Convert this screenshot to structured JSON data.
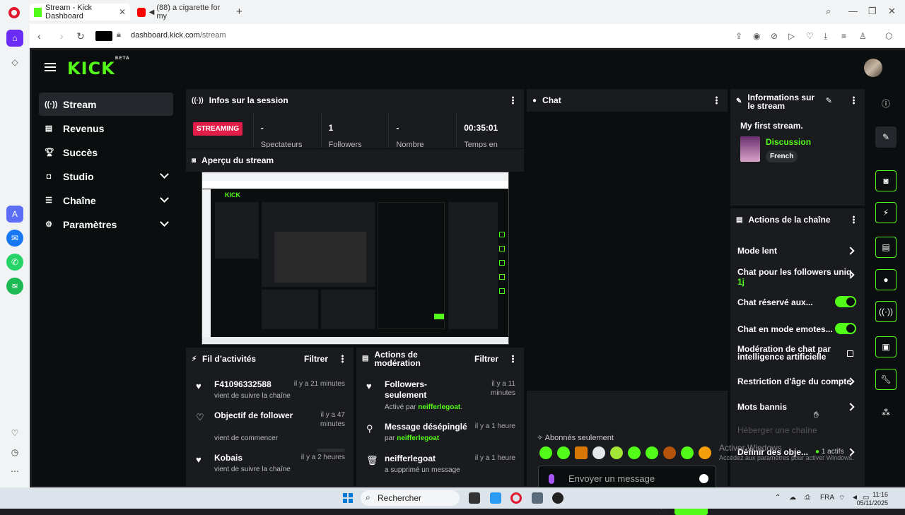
{
  "browser": {
    "tabs": [
      {
        "title": "Stream - Kick Dashboard",
        "active": true
      },
      {
        "title": "(88) a cigarette for my",
        "active": false
      }
    ],
    "url_domain": "dashboard.kick.com",
    "url_path": "/stream"
  },
  "app": {
    "logo": "KICK",
    "logo_badge": "BETA",
    "accent_color": "#53fc18"
  },
  "sidebar": {
    "items": [
      {
        "label": "Stream",
        "icon": "broadcast-icon",
        "active": true
      },
      {
        "label": "Revenus",
        "icon": "chart-icon"
      },
      {
        "label": "Succès",
        "icon": "trophy-icon"
      },
      {
        "label": "Studio",
        "icon": "studio-icon",
        "expandable": true
      },
      {
        "label": "Chaîne",
        "icon": "channel-icon",
        "expandable": true
      },
      {
        "label": "Paramètres",
        "icon": "gear-icon",
        "expandable": true
      }
    ]
  },
  "session": {
    "title": "Infos sur la session",
    "status": "STREAMING",
    "stats": [
      {
        "value": "-",
        "label": "Spectateurs"
      },
      {
        "value": "1",
        "label": "Followers"
      },
      {
        "value": "-",
        "label": "Nombre"
      },
      {
        "value": "00:35:01",
        "label": "Temps en"
      }
    ]
  },
  "preview": {
    "title": "Aperçu du stream"
  },
  "activity": {
    "title": "Fil d’activités",
    "filter": "Filtrer",
    "items": [
      {
        "icon": "heart-icon",
        "name": "F41096332588",
        "desc": "vient de suivre la chaîne",
        "time": "il y a 21 minutes"
      },
      {
        "icon": "heart-outline-icon",
        "name": "Objectif de follower",
        "desc": "vient de commencer",
        "time": "il y a 47 minutes"
      },
      {
        "icon": "heart-icon",
        "name": "Kobais",
        "desc": "vient de suivre la chaîne",
        "time": "il y a 2 heures"
      }
    ]
  },
  "moderation": {
    "title": "Actions de modération",
    "filter": "Filtrer",
    "items": [
      {
        "icon": "heart-icon",
        "name": "Followers-seulement",
        "desc": "Activé par",
        "user": "neifferlegoat",
        "suffix": ".",
        "time": "il y a 11 minutes"
      },
      {
        "icon": "unpin-icon",
        "name": "Message désépinglé",
        "desc": "par",
        "user": "neifferlegoat",
        "suffix": "",
        "time": "il y a 1 heure"
      },
      {
        "icon": "trash-icon",
        "name": "neifferlegoat",
        "desc": "a supprimé un message",
        "user": "",
        "suffix": "",
        "time": "il y a 1 heure"
      }
    ]
  },
  "chat": {
    "title": "Chat",
    "mode": "Abonnés seulement",
    "placeholder": "Envoyer un message",
    "send": "Chat"
  },
  "stream_info": {
    "title": "Informations sur le stream",
    "stream_title": "My first stream.",
    "category": "Discussion",
    "language": "French"
  },
  "channel_actions": {
    "title": "Actions de la chaîne",
    "items": [
      {
        "label": "Mode lent",
        "control": "chevron"
      },
      {
        "label": "Chat pour les followers uniquement",
        "sub": "1j",
        "control": "chevron"
      },
      {
        "label": "Chat réservé aux...",
        "control": "toggle-on"
      },
      {
        "label": "Chat en mode emotes...",
        "control": "toggle-on"
      },
      {
        "label": "Modération de chat par intelligence artificielle",
        "control": "external"
      },
      {
        "label": "Restriction d'âge du compte",
        "control": "chevron"
      },
      {
        "label": "Mots bannis",
        "control": "chevron"
      },
      {
        "label": "Héberger une chaîne",
        "control": "disabled"
      },
      {
        "label": "Définir des obje...",
        "badge": "1 actifs",
        "control": "chevron"
      }
    ]
  },
  "os": {
    "search": "Rechercher",
    "lang": "FRA",
    "time": "11:16",
    "date": "05/11/2025",
    "watermark_title": "Activer Windows",
    "watermark_sub": "Accédez aux paramètres pour activer Windows."
  }
}
